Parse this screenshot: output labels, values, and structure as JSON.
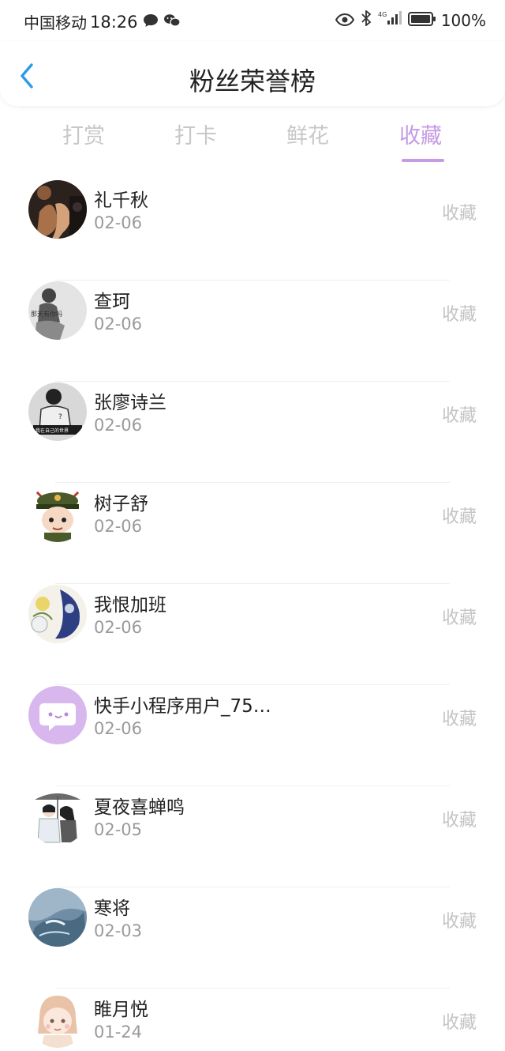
{
  "status_bar": {
    "carrier": "中国移动",
    "time": "18:26",
    "network": "4G",
    "battery": "100%"
  },
  "header": {
    "title": "粉丝荣誉榜"
  },
  "tabs": [
    {
      "label": "打赏",
      "active": false
    },
    {
      "label": "打卡",
      "active": false
    },
    {
      "label": "鲜花",
      "active": false
    },
    {
      "label": "收藏",
      "active": true
    }
  ],
  "colors": {
    "accent": "#c59be3",
    "inactive_tab": "#c8c8c8",
    "date": "#9a9a9a",
    "action": "#c4c4c4",
    "back_arrow": "#2a9be8"
  },
  "fans": [
    {
      "name": "礼千秋",
      "date": "02-06",
      "action": "收藏",
      "avatar_icon": "avatar-dark-portrait"
    },
    {
      "name": "查珂",
      "date": "02-06",
      "action": "收藏",
      "avatar_icon": "avatar-sketch-portrait",
      "avatar_caption": "那天有你吗"
    },
    {
      "name": "张廖诗兰",
      "date": "02-06",
      "action": "收藏",
      "avatar_icon": "avatar-bw-photo",
      "avatar_caption": "我在自己的世界"
    },
    {
      "name": "树子舒",
      "date": "02-06",
      "action": "收藏",
      "avatar_icon": "avatar-cartoon-soldier"
    },
    {
      "name": "我恨加班",
      "date": "02-06",
      "action": "收藏",
      "avatar_icon": "avatar-floral-art"
    },
    {
      "name": "快手小程序用户_75…",
      "date": "02-06",
      "action": "收藏",
      "avatar_icon": "avatar-chat-bubble"
    },
    {
      "name": "夏夜喜蝉鸣",
      "date": "02-05",
      "action": "收藏",
      "avatar_icon": "avatar-anime-couple"
    },
    {
      "name": "寒将",
      "date": "02-03",
      "action": "收藏",
      "avatar_icon": "avatar-ice-landscape"
    },
    {
      "name": "睢月悦",
      "date": "01-24",
      "action": "收藏",
      "avatar_icon": "avatar-cartoon-girl"
    }
  ]
}
